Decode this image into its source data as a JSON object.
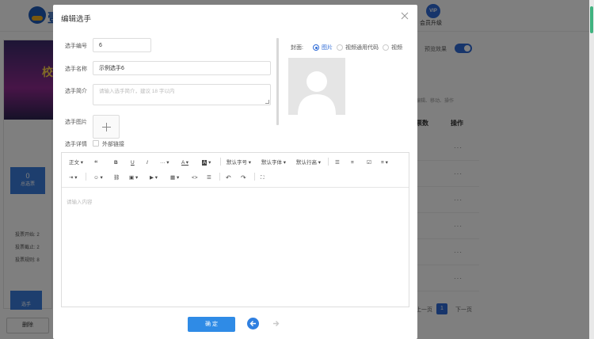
{
  "background": {
    "vip_label": "会员升级",
    "effect_label": "预览效果",
    "ops_hint": "编辑、移动、操作",
    "col_votes": "票数",
    "col_ops": "操作",
    "row_ops": "···",
    "stat_num": "0",
    "stat_label": "总选票",
    "info": [
      "投票开始: 2",
      "投票截止: 2",
      "投票规则: 8"
    ],
    "bottom_tab": "选手",
    "delete_btn": "删除",
    "pager": {
      "prev": "上一页",
      "current": "1",
      "next": "下一页"
    }
  },
  "modal": {
    "title": "编辑选手",
    "close_icon": "close-icon",
    "fields": {
      "number_label": "选手编号",
      "number_value": "6",
      "name_label": "选手名称",
      "name_value": "示例选手6",
      "intro_label": "选手简介",
      "intro_placeholder": "请输入选手简介，建议 18 字以内",
      "image_label": "选手图片",
      "detail_label": "选手详情",
      "external_link_label": "外部链接"
    },
    "cover": {
      "label": "封面:",
      "options": [
        "图片",
        "视频通用代码",
        "视频"
      ],
      "selected": "图片"
    },
    "editor": {
      "toolbar_row1": [
        "正文",
        "“",
        "B",
        "U",
        "I",
        "···",
        "A",
        "A",
        "默认字号",
        "默认字体",
        "默认行高"
      ],
      "toolbar_row2": [
        "☺",
        "⛓",
        "▣",
        "▶",
        "▦",
        "<>",
        "☰",
        "↶",
        "↷",
        "⛶"
      ],
      "placeholder": "请输入内容"
    },
    "confirm_label": "确 定"
  }
}
